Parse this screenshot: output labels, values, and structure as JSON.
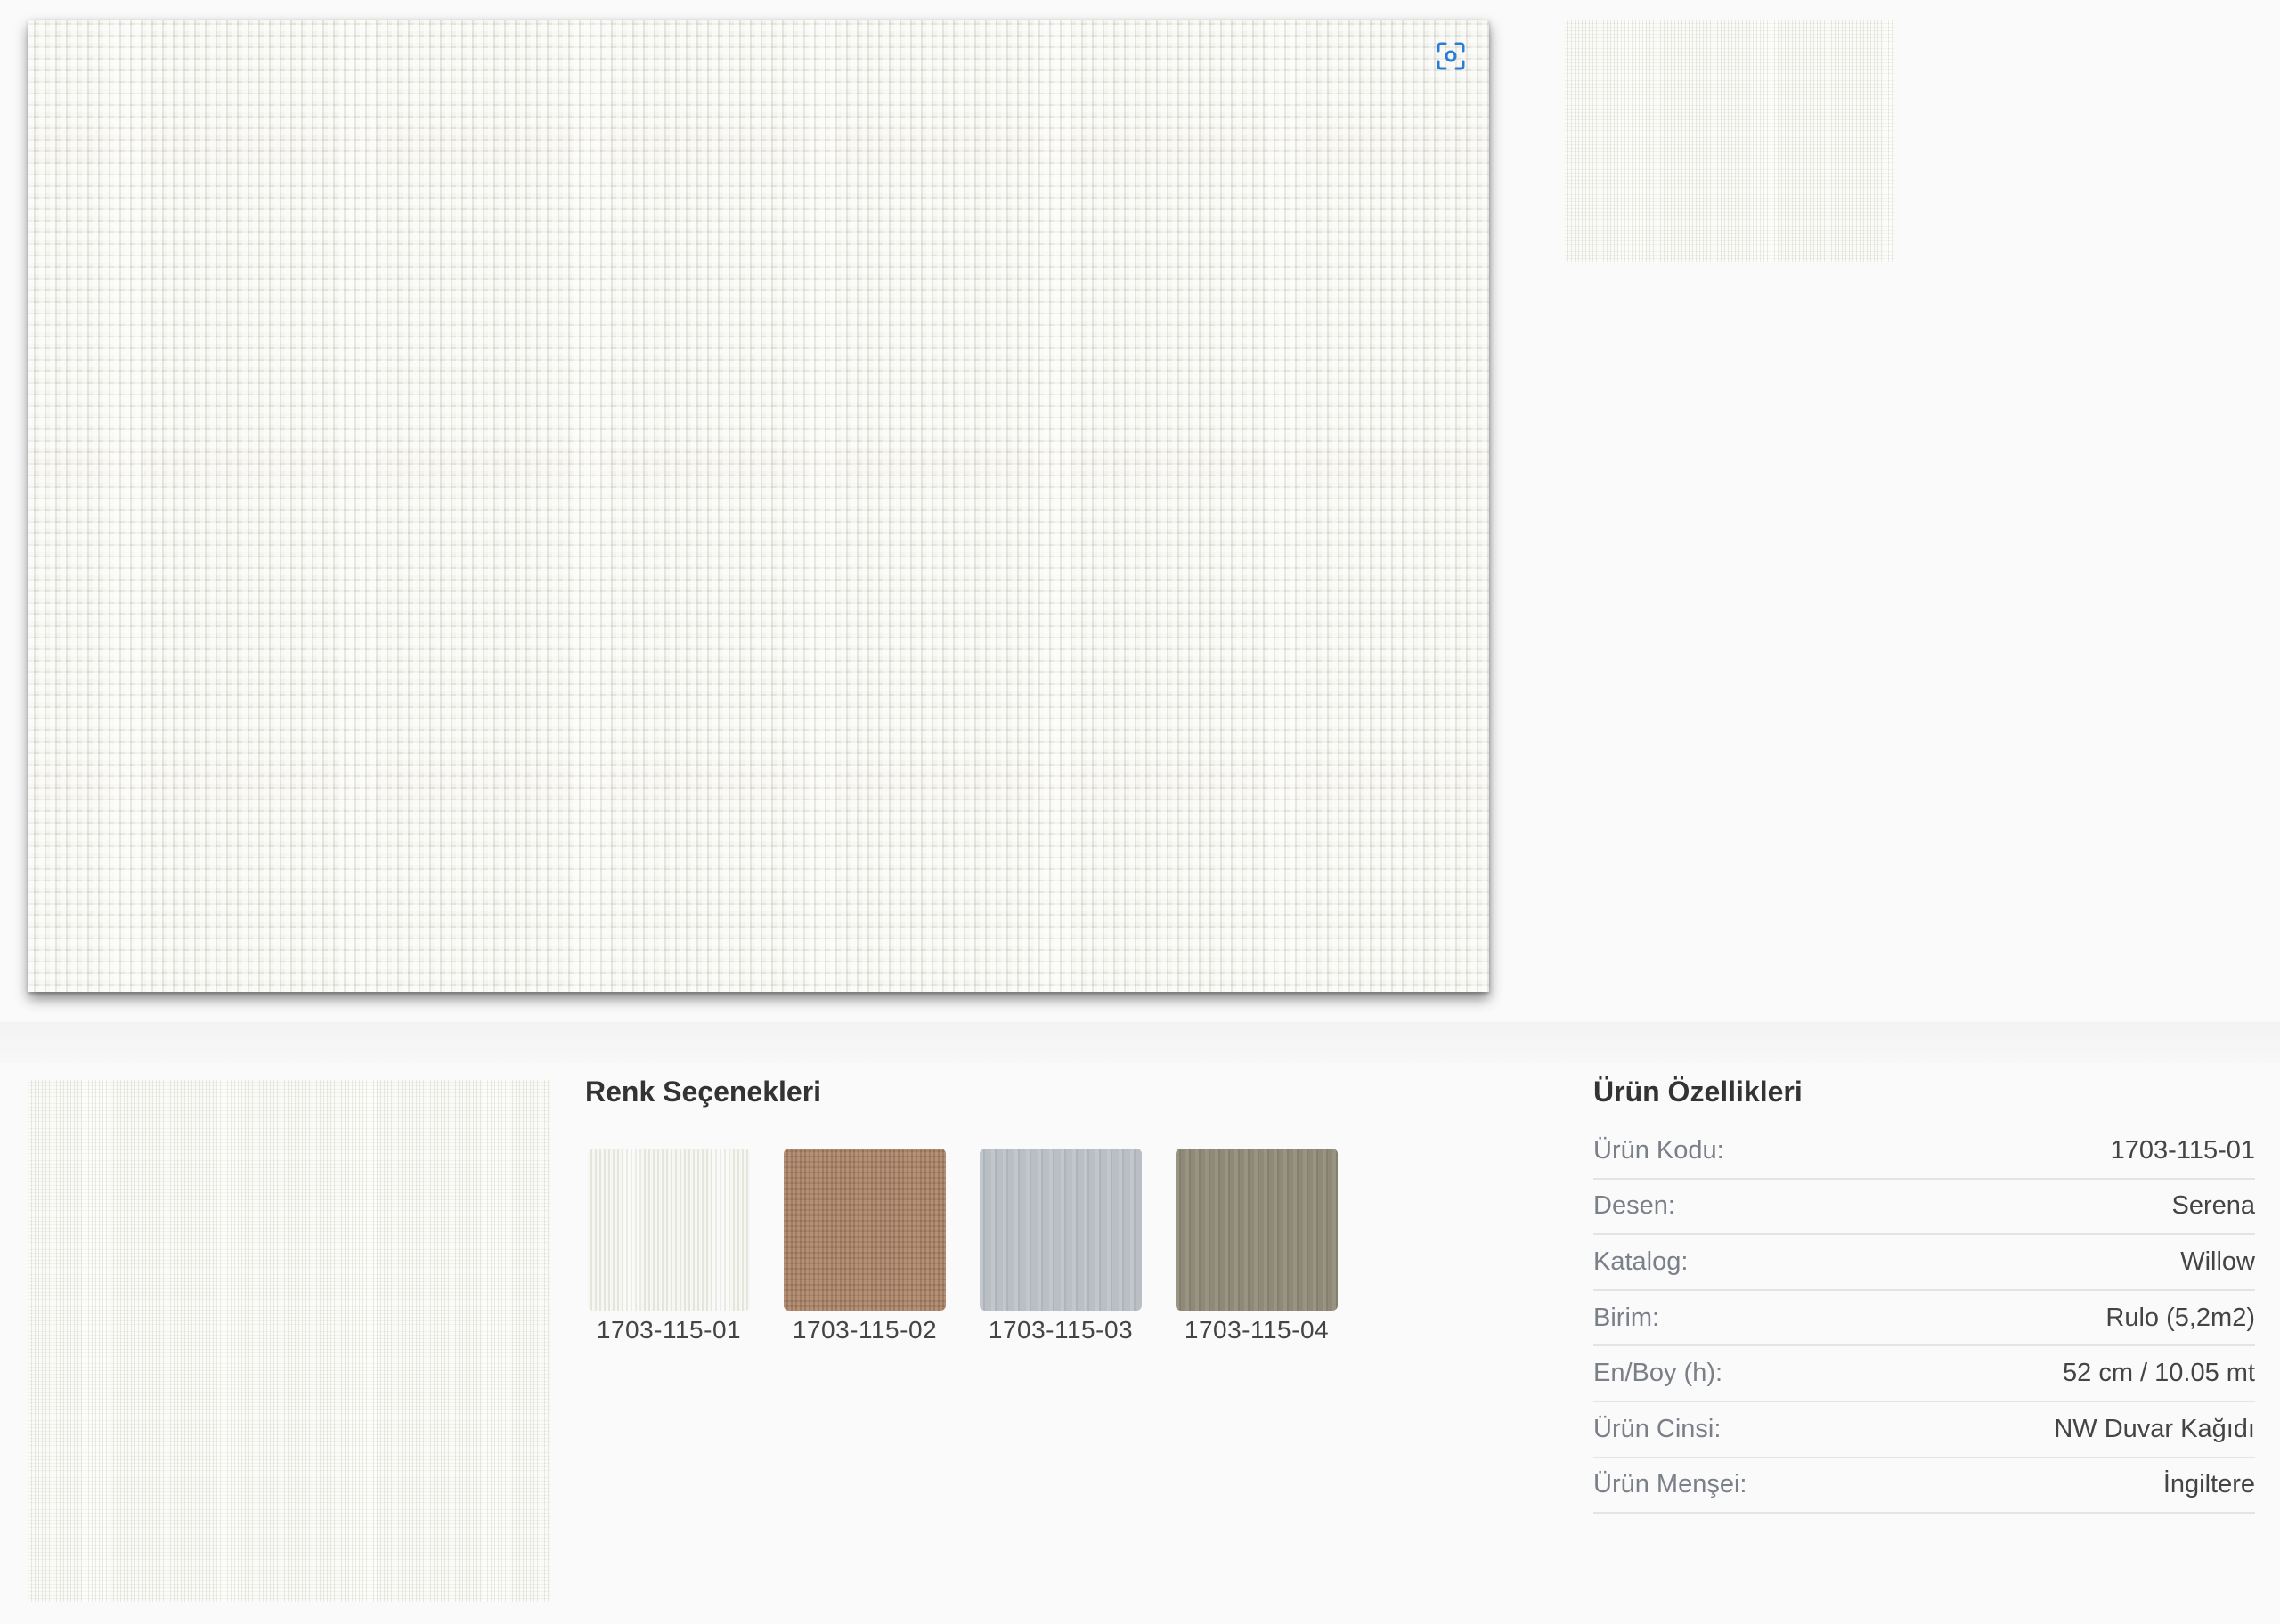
{
  "gallery": {
    "zoom_icon": "zoom-focus-icon",
    "accent_color": "#2a7dd6"
  },
  "color_options": {
    "title": "Renk Seçenekleri",
    "items": [
      {
        "code": "1703-115-01",
        "color": "#ecede4"
      },
      {
        "code": "1703-115-02",
        "color": "#a87f62"
      },
      {
        "code": "1703-115-03",
        "color": "#b9bfc5"
      },
      {
        "code": "1703-115-04",
        "color": "#8f8a78"
      }
    ]
  },
  "product_specs": {
    "title": "Ürün Özellikleri",
    "rows": [
      {
        "label": "Ürün Kodu:",
        "value": "1703-115-01"
      },
      {
        "label": "Desen:",
        "value": "Serena"
      },
      {
        "label": "Katalog:",
        "value": "Willow"
      },
      {
        "label": "Birim:",
        "value": "Rulo (5,2m2)"
      },
      {
        "label": "En/Boy (h):",
        "value": "52 cm / 10.05 mt"
      },
      {
        "label": "Ürün Cinsi:",
        "value": "NW Duvar Kağıdı"
      },
      {
        "label": "Ürün Menşei:",
        "value": "İngiltere"
      }
    ]
  }
}
